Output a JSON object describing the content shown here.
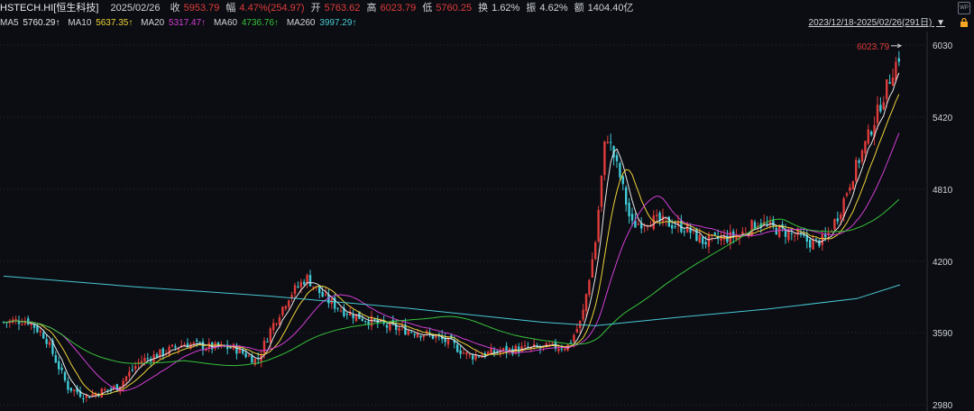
{
  "header": {
    "symbol": "HSTECH.HI[恒生科技]",
    "date": "2025/02/26",
    "close_label": "收",
    "close": "5953.79",
    "change_label": "幅",
    "change": "4.47%(254.97)",
    "open_label": "开",
    "open": "5763.62",
    "high_label": "高",
    "high": "6023.79",
    "low_label": "低",
    "low": "5760.25",
    "turnover_label": "换",
    "turnover": "1.62%",
    "amplitude_label": "振",
    "amplitude": "4.62%",
    "amount_label": "额",
    "amount": "1404.40亿"
  },
  "ma": {
    "ma5_label": "MA5",
    "ma5": "5760.29↑",
    "ma10_label": "MA10",
    "ma10": "5637.35↑",
    "ma20_label": "MA20",
    "ma20": "5317.47↑",
    "ma60_label": "MA60",
    "ma60": "4736.76↑",
    "ma260_label": "MA260",
    "ma260": "3997.29↑"
  },
  "range_label": "2023/12/18-2025/02/26(291日)",
  "y_ticks": [
    "6030",
    "5420",
    "4810",
    "4200",
    "3590",
    "2980"
  ],
  "high_marker": "6023.79",
  "colors": {
    "up": "#e03b3b",
    "down": "#3fc9d6",
    "ma5": "#e8e8e8",
    "ma10": "#f0d23a",
    "ma20": "#d43ed6",
    "ma60": "#37c23a",
    "ma260": "#49c9d4",
    "accent": "#f5a623"
  }
}
